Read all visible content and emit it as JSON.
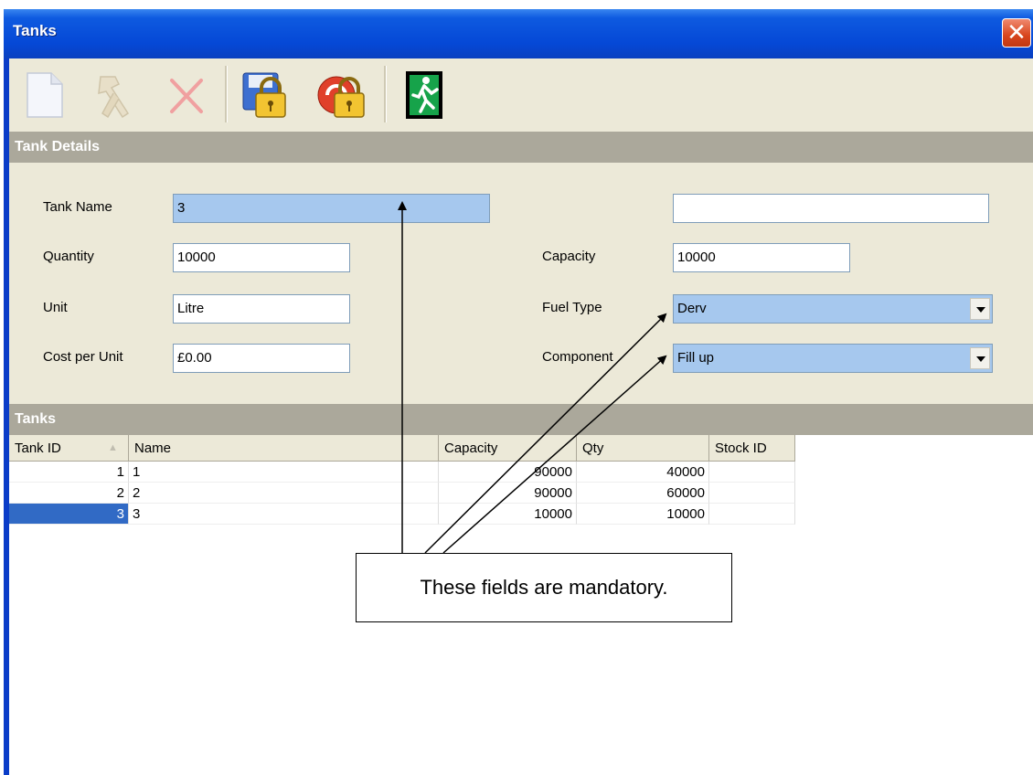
{
  "window": {
    "title": "Tanks"
  },
  "toolbar": {
    "buttons": [
      "new-document-icon",
      "tools-icon",
      "delete-icon",
      "save-lock-icon",
      "cancel-lock-icon",
      "exit-icon"
    ]
  },
  "details": {
    "section_title": "Tank Details",
    "tank_name_label": "Tank Name",
    "tank_name_value": "3",
    "extra_field_value": "",
    "quantity_label": "Quantity",
    "quantity_value": "10000",
    "capacity_label": "Capacity",
    "capacity_value": "10000",
    "unit_label": "Unit",
    "unit_value": "Litre",
    "fuel_type_label": "Fuel Type",
    "fuel_type_value": "Derv",
    "cost_label": "Cost per Unit",
    "cost_value": "£0.00",
    "component_label": "Component",
    "component_value": "Fill up"
  },
  "grid": {
    "section_title": "Tanks",
    "headers": [
      "Tank ID",
      "Name",
      "Capacity",
      "Qty",
      "Stock ID"
    ],
    "rows": [
      [
        "1",
        "1",
        "90000",
        "40000",
        ""
      ],
      [
        "2",
        "2",
        "90000",
        "60000",
        ""
      ],
      [
        "3",
        "3",
        "10000",
        "10000",
        ""
      ]
    ],
    "selected_row": 3
  },
  "annotation": {
    "text": "These fields are mandatory."
  },
  "colors": {
    "mandatory": "#a6c8ee",
    "title_bar": "#0548d6",
    "section_bar": "#aba89b",
    "selection": "#316ac5"
  }
}
